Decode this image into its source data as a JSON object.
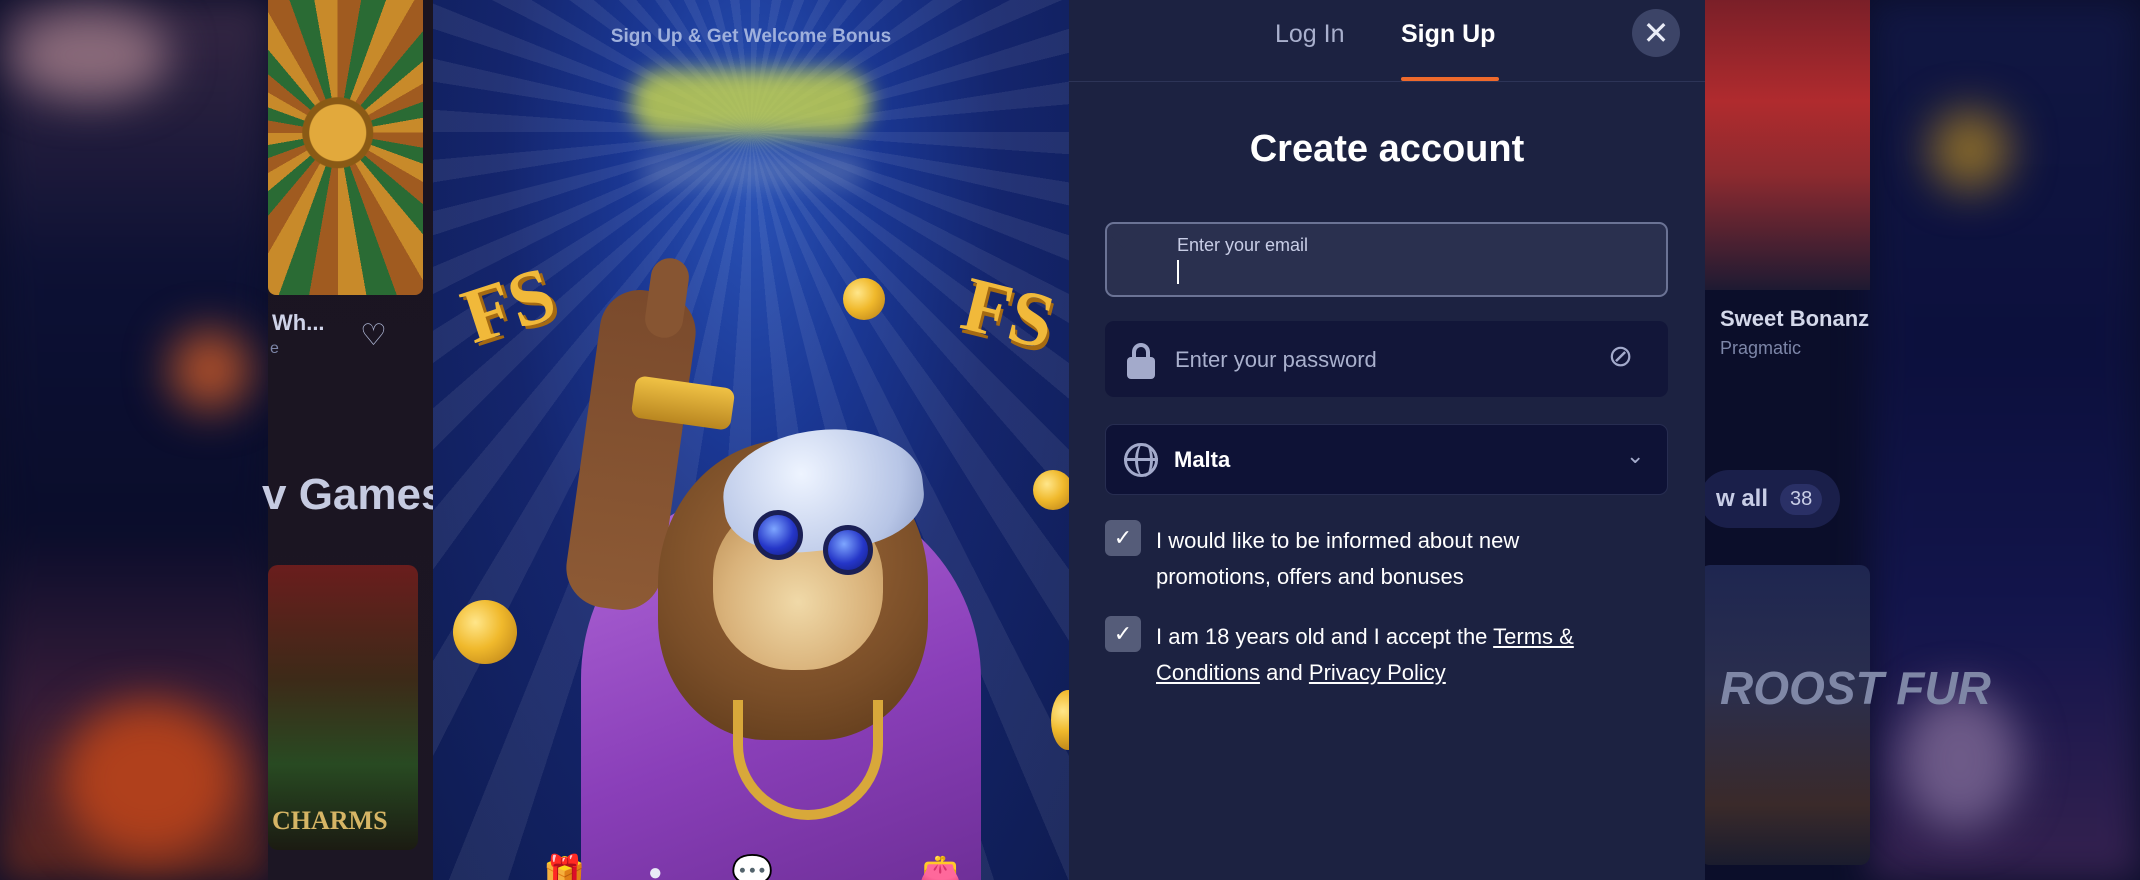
{
  "background": {
    "left_game_title": "Wh...",
    "left_game_sub": "e",
    "left_section_title": "v Games",
    "left_card_label": "CHARMS",
    "right_game_title": "Sweet Bonanz",
    "right_game_provider": "Pragmatic",
    "view_all_label": "w all",
    "view_all_count": "38",
    "right_card_label": "ROOST FUR"
  },
  "promo": {
    "title": "Sign Up & Get Welcome Bonus",
    "fs_label": "FS"
  },
  "modal": {
    "tabs": [
      {
        "label": "Log In",
        "active": false
      },
      {
        "label": "Sign Up",
        "active": true
      }
    ],
    "close_icon": "close-icon",
    "heading": "Create account",
    "email": {
      "label": "Enter your email",
      "value": "",
      "icon": "envelope-icon"
    },
    "password": {
      "placeholder": "Enter your password",
      "icon": "lock-icon",
      "toggle_icon": "eye-off-icon"
    },
    "country": {
      "value": "Malta",
      "icon": "globe-icon",
      "chevron": "chevron-down-icon"
    },
    "consents": [
      {
        "checked": true,
        "text": "I would like to be informed about new promotions, offers and bonuses"
      },
      {
        "checked": true,
        "prefix": "I am 18 years old and I accept the ",
        "terms_link": "Terms & Conditions",
        "middle": " and ",
        "privacy_link": "Privacy Policy"
      }
    ]
  },
  "colors": {
    "accent": "#ef6a2c",
    "modal_bg": "#1c2241",
    "field_bg": "#121639"
  }
}
